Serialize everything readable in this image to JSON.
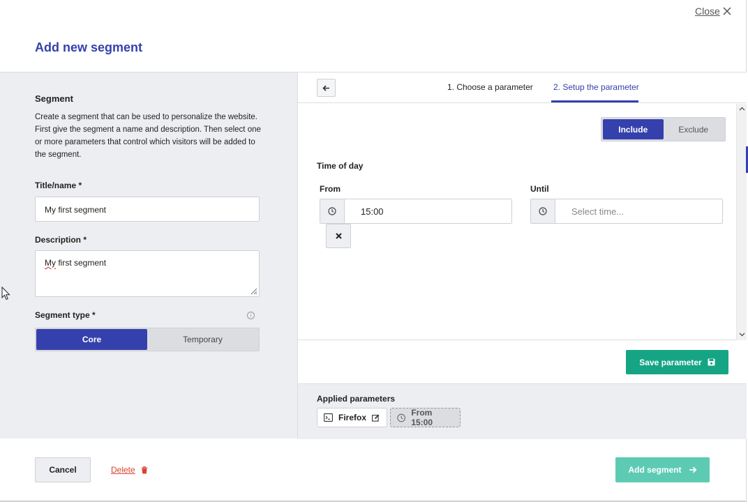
{
  "header": {
    "title": "Add new segment",
    "close_label": "Close"
  },
  "segment": {
    "heading": "Segment",
    "description": "Create a segment that can be used to personalize the website. First give the segment a name and description. Then select one or more parameters that control which visitors will be added to the segment.",
    "title_label": "Title/name *",
    "title_value": "My first segment",
    "description_label": "Description *",
    "description_value_first": "My",
    "description_value_rest": " first segment",
    "type_label": "Segment type *",
    "type_options": [
      "Core",
      "Temporary"
    ],
    "type_selected": "Core"
  },
  "wizard": {
    "steps": [
      "1. Choose a parameter",
      "2. Setup the parameter"
    ],
    "active_step": 2,
    "include_options": [
      "Include",
      "Exclude"
    ],
    "include_selected": "Include",
    "section_label": "Time of day",
    "from_label": "From",
    "from_value": "15:00",
    "until_label": "Until",
    "until_placeholder": "Select time...",
    "save_label": "Save parameter"
  },
  "applied": {
    "label": "Applied parameters",
    "chips": [
      {
        "label": "Firefox",
        "icon": "terminal-icon",
        "state": "saved"
      },
      {
        "label": "From 15:00",
        "icon": "clock-icon",
        "state": "pending"
      }
    ]
  },
  "footer": {
    "cancel_label": "Cancel",
    "delete_label": "Delete",
    "add_label": "Add segment"
  },
  "colors": {
    "primary": "#3441ad",
    "success": "#15a584",
    "success_disabled": "#5dcbb3",
    "danger": "#d9432f"
  }
}
